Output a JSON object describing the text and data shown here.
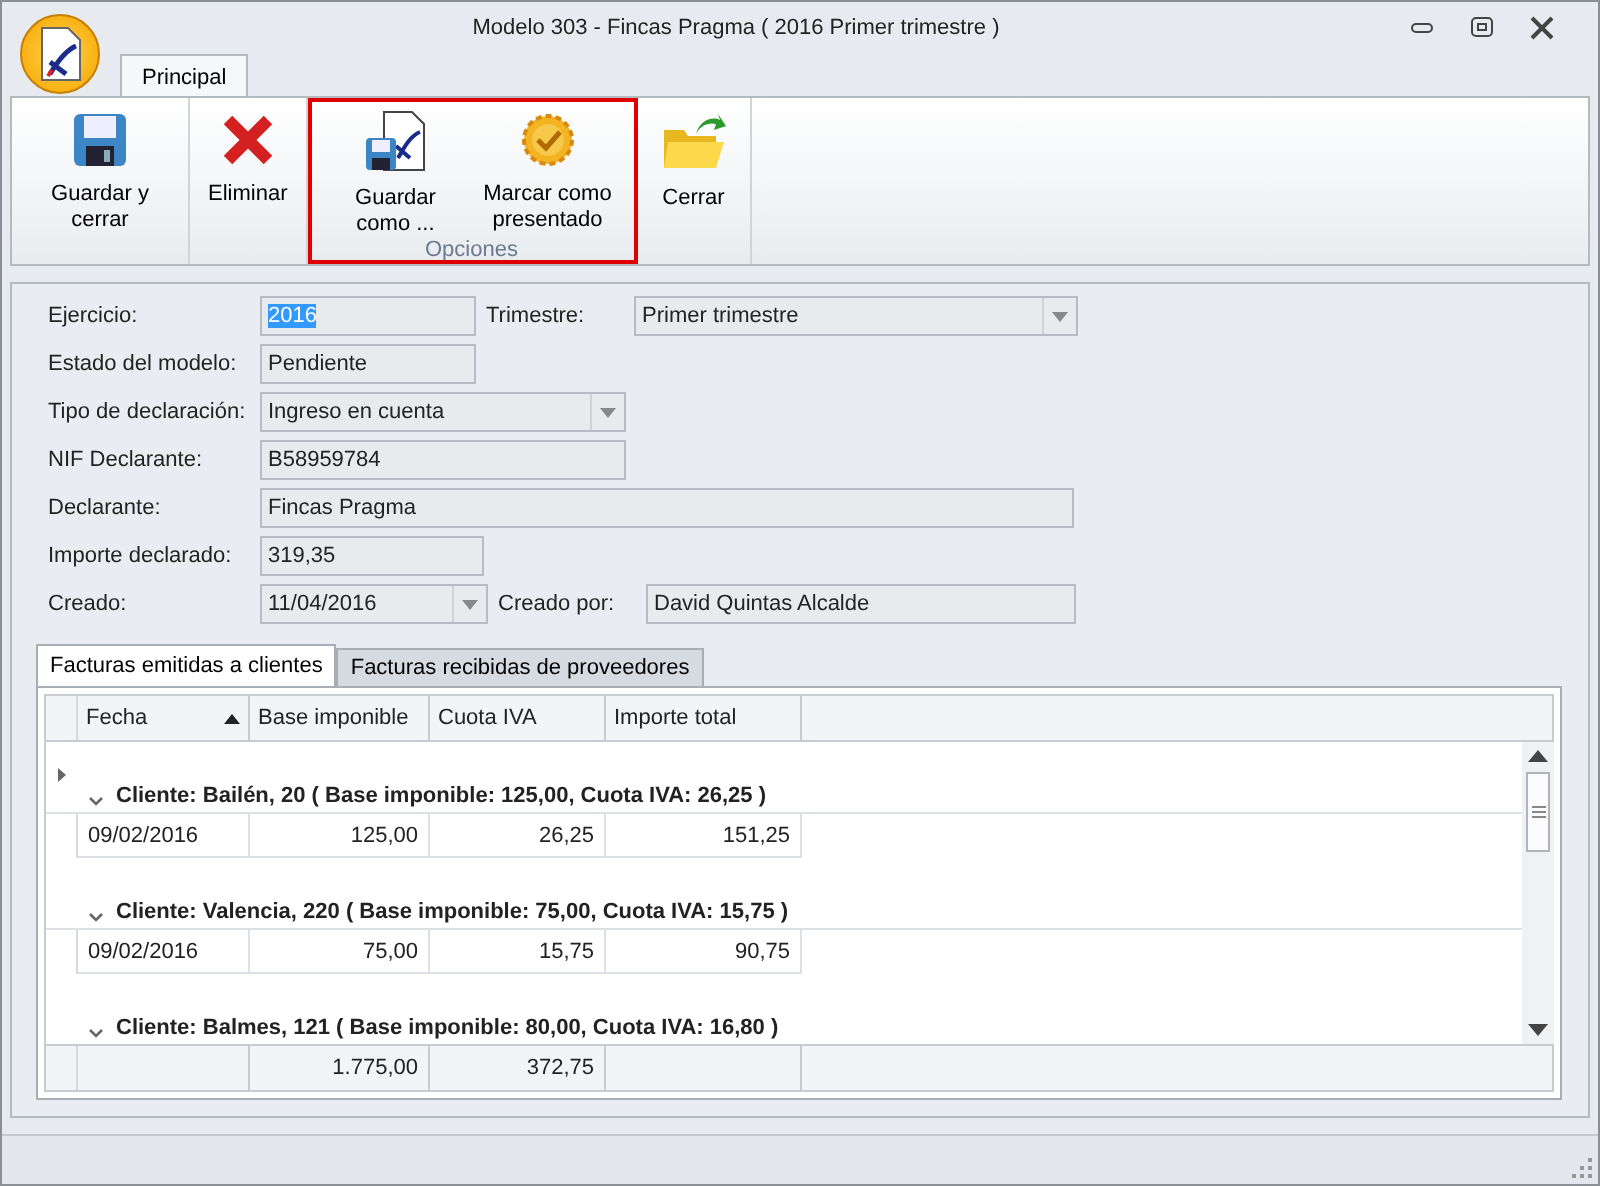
{
  "window": {
    "title": "Modelo 303 - Fincas Pragma ( 2016 Primer trimestre )"
  },
  "ribbon_tabs": [
    {
      "label": "Principal",
      "selected": true
    }
  ],
  "ribbon_groups": [
    {
      "buttons": [
        {
          "label": "Guardar y cerrar",
          "kind": "save"
        }
      ]
    },
    {
      "buttons": [
        {
          "label": "Eliminar",
          "kind": "delete"
        }
      ]
    },
    {
      "label": "Opciones",
      "highlighted": true,
      "buttons": [
        {
          "label": "Guardar como ...",
          "kind": "save-as"
        },
        {
          "label": "Marcar como presentado",
          "kind": "mark"
        }
      ]
    },
    {
      "buttons": [
        {
          "label": "Cerrar",
          "kind": "close"
        }
      ]
    }
  ],
  "form_rows": [
    [
      {
        "label": "Ejercicio:",
        "value": "2016",
        "kind": "text",
        "highlighted": true
      },
      {
        "label": "Trimestre:",
        "value": "Primer trimestre",
        "kind": "dropdown"
      }
    ],
    [
      {
        "label": "Estado del modelo:",
        "value": "Pendiente",
        "kind": "text"
      }
    ],
    [
      {
        "label": "Tipo de declaración:",
        "value": "Ingreso en cuenta",
        "kind": "dropdown"
      }
    ],
    [
      {
        "label": "NIF Declarante:",
        "value": "B58959784",
        "kind": "text"
      }
    ],
    [
      {
        "label": "Declarante:",
        "value": "Fincas Pragma",
        "kind": "text"
      }
    ],
    [
      {
        "label": "Importe declarado:",
        "value": "319,35",
        "kind": "text"
      }
    ],
    [
      {
        "label": "Creado:",
        "value": "11/04/2016",
        "kind": "dropdown"
      },
      {
        "label": "Creado por:",
        "value": "David Quintas Alcalde",
        "kind": "text"
      }
    ]
  ],
  "tabs": [
    {
      "label": "Facturas emitidas a clientes",
      "selected": true
    },
    {
      "label": "Facturas recibidas de proveedores",
      "selected": false
    }
  ],
  "table": {
    "columns": [
      {
        "label": "Fecha",
        "sorted": true
      },
      {
        "label": "Base imponible",
        "sorted": false
      },
      {
        "label": "Cuota IVA",
        "sorted": false
      },
      {
        "label": "Importe total",
        "sorted": false
      }
    ],
    "groups": [
      {
        "label": "Cliente: Bailén, 20 ( Base imponible: 125,00, Cuota IVA: 26,25 )",
        "expanded": true,
        "focused": true,
        "rows": [
          [
            "09/02/2016",
            "125,00",
            "26,25",
            "151,25"
          ]
        ]
      },
      {
        "label": "Cliente: Valencia, 220 ( Base imponible: 75,00, Cuota IVA: 15,75 )",
        "expanded": true,
        "focused": false,
        "rows": [
          [
            "09/02/2016",
            "75,00",
            "15,75",
            "90,75"
          ]
        ]
      },
      {
        "label": "Cliente: Balmes, 121 ( Base imponible: 80,00, Cuota IVA: 16,80 )",
        "expanded": true,
        "focused": false
      }
    ],
    "totals": {
      "base_imponible": "1.775,00",
      "cuota_iva": "372,75"
    }
  }
}
